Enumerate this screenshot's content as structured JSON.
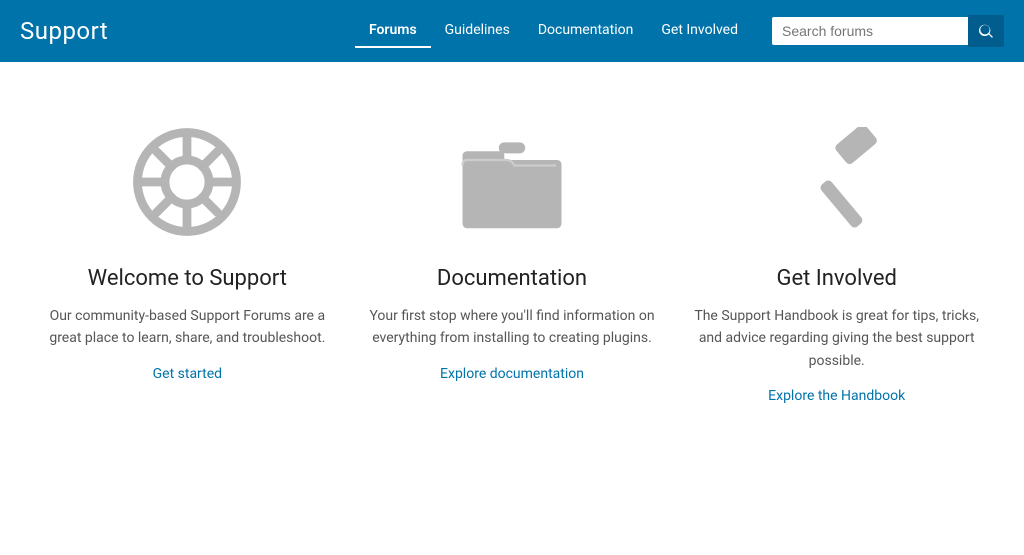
{
  "header": {
    "logo": "Support",
    "nav": {
      "items": [
        {
          "label": "Forums",
          "active": true
        },
        {
          "label": "Guidelines",
          "active": false
        },
        {
          "label": "Documentation",
          "active": false
        },
        {
          "label": "Get Involved",
          "active": false
        }
      ]
    },
    "search": {
      "placeholder": "Search forums",
      "button_label": "Search"
    }
  },
  "main": {
    "cards": [
      {
        "icon": "lifesaver-icon",
        "title": "Welcome to Support",
        "description": "Our community-based Support Forums are a great place to learn, share, and troubleshoot.",
        "link_label": "Get started",
        "link_url": "#"
      },
      {
        "icon": "folder-icon",
        "title": "Documentation",
        "description": "Your first stop where you'll find information on everything from installing to creating plugins.",
        "link_label": "Explore documentation",
        "link_url": "#"
      },
      {
        "icon": "hammer-icon",
        "title": "Get Involved",
        "description": "The Support Handbook is great for tips, tricks, and advice regarding giving the best support possible.",
        "link_label": "Explore the Handbook",
        "link_url": "#"
      }
    ]
  }
}
